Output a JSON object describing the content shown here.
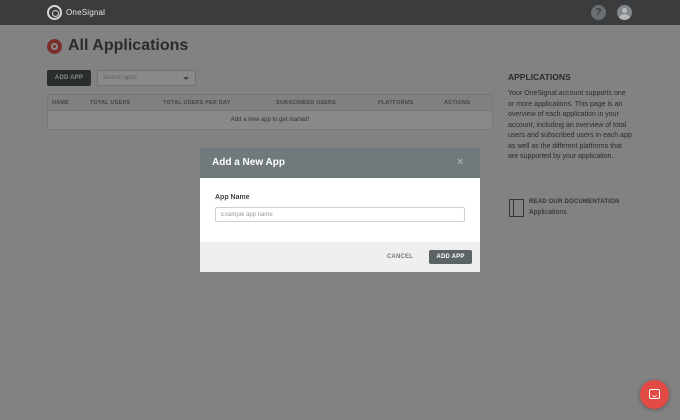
{
  "topbar": {
    "brand_name": "OneSignal",
    "help_glyph": "?"
  },
  "page": {
    "title": "All Applications",
    "add_app_label": "ADD APP",
    "search_placeholder": "Search apps"
  },
  "table": {
    "columns": [
      "NAME",
      "TOTAL USERS",
      "TOTAL USERS PER DAY",
      "SUBSCRIBED USERS",
      "PLATFORMS",
      "ACTIONS"
    ],
    "empty_message": "Add a new app to get started!"
  },
  "sidebar": {
    "heading": "APPLICATIONS",
    "description": "Your OneSignal account supports one or more applications. This page is an overview of each application in your account, including an overview of total users and subscribed users in each app as well as the different platforms that are supported by your application.",
    "doc_title": "READ OUR DOCUMENTATION",
    "doc_link": "Applications"
  },
  "modal": {
    "title": "Add a New App",
    "close_glyph": "×",
    "field_label": "App Name",
    "input_placeholder": "Example app name",
    "input_value": "",
    "cancel_label": "CANCEL",
    "submit_label": "ADD APP"
  },
  "colors": {
    "topbar": "#3a3c3e",
    "accent_red": "#e14b43",
    "modal_header": "#707a7c",
    "primary_button": "#3f4648"
  },
  "icons": {
    "brand": "onesignal-logo-icon",
    "help": "help-icon",
    "avatar": "user-avatar-icon",
    "page": "applications-icon",
    "close": "close-icon",
    "docs": "book-icon",
    "chat": "chat-icon"
  }
}
